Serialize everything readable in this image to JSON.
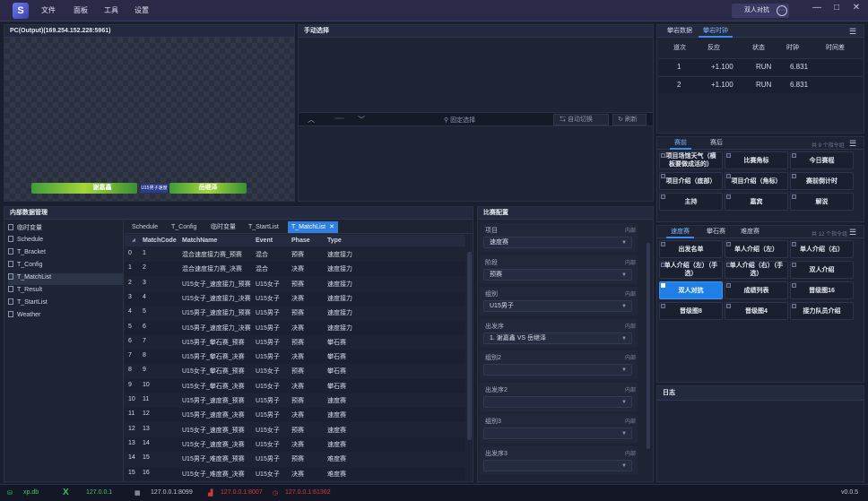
{
  "titlebar": {
    "menu": [
      "文件",
      "面板",
      "工具",
      "设置"
    ],
    "mode_button": "双人对抗",
    "dots": "···",
    "controls": [
      "—",
      "□",
      "✕"
    ]
  },
  "output": {
    "title": "PC(Output)(169.254.152.228:5961)",
    "left_name": "谢嘉鑫",
    "right_name": "岳继泽",
    "center_text": "U15男子速度赛"
  },
  "manual": {
    "title": "手动选择",
    "fix_label": "固定选择",
    "auto_label": "自动切换",
    "refresh_label": "刷新"
  },
  "timing": {
    "tabs": [
      "攀岩数据",
      "攀岩时钟"
    ],
    "headers": [
      "道次",
      "反应",
      "状态",
      "时钟",
      "时间差"
    ],
    "rows": [
      [
        "1",
        "+1.100",
        "RUN",
        "6.831",
        ""
      ],
      [
        "2",
        "+1.100",
        "RUN",
        "6.831",
        ""
      ]
    ]
  },
  "pre": {
    "tabs": [
      "赛前",
      "赛后"
    ],
    "count": "共 9 个指令组",
    "buttons": [
      [
        "项目场馆天气（横板要做成活的）",
        false
      ],
      [
        "比赛角标",
        false
      ],
      [
        "今日赛程",
        false
      ],
      [
        "项目介绍（底部）",
        false
      ],
      [
        "项目介绍（角标）",
        false
      ],
      [
        "赛前倒计时",
        false
      ],
      [
        "主持",
        false
      ],
      [
        "嘉宾",
        false
      ],
      [
        "解说",
        false
      ]
    ]
  },
  "speed": {
    "tabs": [
      "速度赛",
      "攀石赛",
      "难度赛"
    ],
    "count": "共 12 个指令组",
    "buttons": [
      [
        "出发名单",
        false
      ],
      [
        "单人介绍（左）",
        false
      ],
      [
        "单人介绍（右）",
        false
      ],
      [
        "单人介绍（左）（手选）",
        false
      ],
      [
        "单人介绍（右）（手选）",
        false
      ],
      [
        "双人介绍",
        false
      ],
      [
        "双人对抗",
        true
      ],
      [
        "成绩列表",
        false
      ],
      [
        "晋级图16",
        false
      ],
      [
        "晋级图8",
        false
      ],
      [
        "晋级图4",
        false
      ],
      [
        "接力队员介绍",
        false
      ]
    ]
  },
  "log": {
    "title": "日志"
  },
  "data_panel": {
    "title": "内部数据管理",
    "sidebar": [
      "临时变量",
      "Schedule",
      "T_Bracket",
      "T_Config",
      "T_MatchList",
      "T_Result",
      "T_StartList",
      "Weather"
    ],
    "tabs": [
      "Schedule",
      "T_Config",
      "临时变量",
      "T_StartList",
      "T_MatchList"
    ],
    "active_close": "✕",
    "headers": [
      "MatchCode",
      "MatchName",
      "Event",
      "Phase",
      "Type"
    ],
    "rows": [
      [
        "0",
        "1",
        "混合速度接力赛_预赛",
        "混合",
        "预赛",
        "速度接力"
      ],
      [
        "1",
        "2",
        "混合速度接力赛_决赛",
        "混合",
        "决赛",
        "速度接力"
      ],
      [
        "2",
        "3",
        "U15女子_速度接力_预赛",
        "U15女子",
        "预赛",
        "速度接力"
      ],
      [
        "3",
        "4",
        "U15女子_速度接力_决赛",
        "U15女子",
        "决赛",
        "速度接力"
      ],
      [
        "4",
        "5",
        "U15男子_速度接力_预赛",
        "U15男子",
        "预赛",
        "速度接力"
      ],
      [
        "5",
        "6",
        "U15男子_速度接力_决赛",
        "U15男子",
        "决赛",
        "速度接力"
      ],
      [
        "6",
        "7",
        "U15男子_攀石赛_预赛",
        "U15男子",
        "预赛",
        "攀石赛"
      ],
      [
        "7",
        "8",
        "U15男子_攀石赛_决赛",
        "U15男子",
        "决赛",
        "攀石赛"
      ],
      [
        "8",
        "9",
        "U15女子_攀石赛_预赛",
        "U15女子",
        "预赛",
        "攀石赛"
      ],
      [
        "9",
        "10",
        "U15女子_攀石赛_决赛",
        "U15女子",
        "决赛",
        "攀石赛"
      ],
      [
        "10",
        "11",
        "U15男子_速度赛_预赛",
        "U15男子",
        "预赛",
        "速度赛"
      ],
      [
        "11",
        "12",
        "U15男子_速度赛_决赛",
        "U15男子",
        "决赛",
        "速度赛"
      ],
      [
        "12",
        "13",
        "U15女子_速度赛_预赛",
        "U15女子",
        "预赛",
        "速度赛"
      ],
      [
        "13",
        "14",
        "U15女子_速度赛_决赛",
        "U15女子",
        "决赛",
        "速度赛"
      ],
      [
        "14",
        "15",
        "U15男子_难度赛_预赛",
        "U15男子",
        "预赛",
        "难度赛"
      ],
      [
        "15",
        "16",
        "U15女子_难度赛_决赛",
        "U15女子",
        "决赛",
        "难度赛"
      ]
    ]
  },
  "config": {
    "title": "比赛配置",
    "tag": "内部",
    "fields": [
      [
        "项目",
        "速度赛"
      ],
      [
        "阶段",
        "预赛"
      ],
      [
        "组别",
        "U15男子"
      ],
      [
        "出发序",
        "1. 谢嘉鑫 VS 岳继泽"
      ],
      [
        "组别2",
        ""
      ],
      [
        "出发序2",
        ""
      ],
      [
        "组别3",
        ""
      ],
      [
        "出发序3",
        ""
      ]
    ]
  },
  "status": {
    "db": "xp.db",
    "ip": "127.0.0.1",
    "port1": "127.0.0.1:8099",
    "port2": "127.0.0.1:8007",
    "port3": "127.0.0.1:61362",
    "version": "v0.0.5"
  }
}
